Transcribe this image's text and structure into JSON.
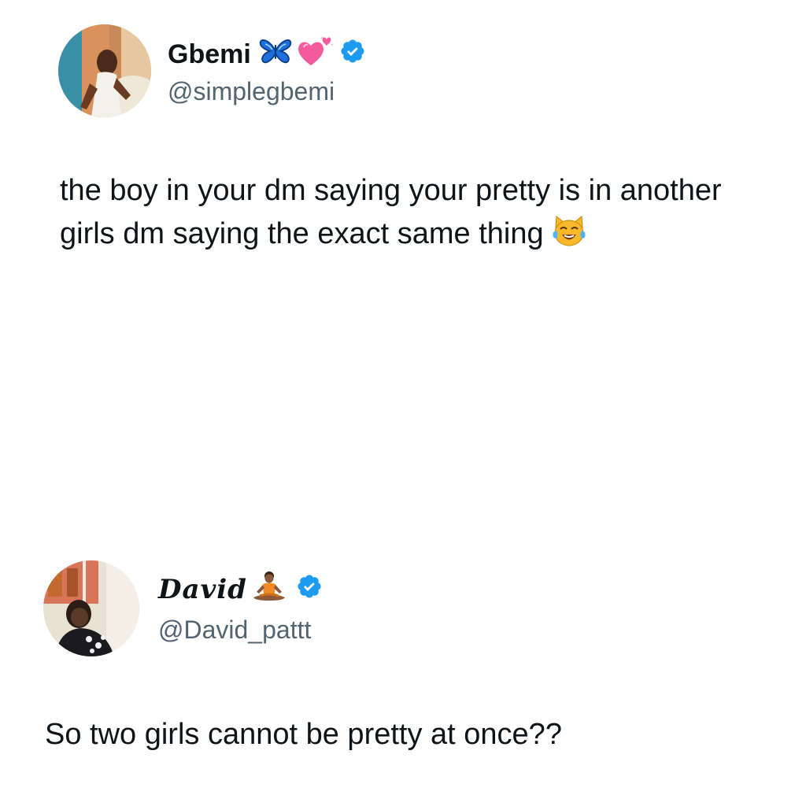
{
  "tweets": [
    {
      "author": {
        "display_name": "Gbemi",
        "name_emojis": [
          "butterfly-icon",
          "heart-with-ribbon-icon"
        ],
        "verified": true,
        "handle": "@simplegbemi"
      },
      "text": "the boy in your dm saying your pretty is in another girls dm saying the exact same thing",
      "text_emoji": "cat-tears-of-joy-icon"
    },
    {
      "author": {
        "display_name": "David",
        "name_emojis": [
          "person-meditating-icon"
        ],
        "verified": true,
        "handle": "@David_pattt"
      },
      "text": "So two girls cannot be pretty at once??"
    }
  ],
  "colors": {
    "text": "#0f1419",
    "secondary_text": "#536471",
    "verified_badge": "#1d9bf0",
    "background": "#ffffff"
  }
}
